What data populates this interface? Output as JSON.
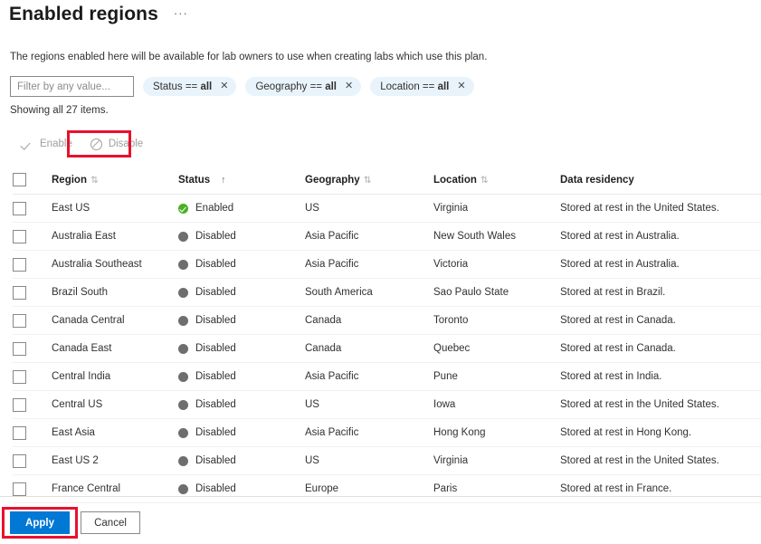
{
  "header": {
    "title": "Enabled regions",
    "ellipsis_label": "···"
  },
  "description": "The regions enabled here will be available for lab owners to use when creating labs which use this plan.",
  "filters": {
    "search_placeholder": "Filter by any value...",
    "search_value": "",
    "pills": [
      {
        "field": "Status",
        "operator": "==",
        "value": "all",
        "close_label": "✕"
      },
      {
        "field": "Geography",
        "operator": "==",
        "value": "all",
        "close_label": "✕"
      },
      {
        "field": "Location",
        "operator": "==",
        "value": "all",
        "close_label": "✕"
      }
    ]
  },
  "showing_text": "Showing all 27 items.",
  "commandbar": {
    "enable_label": "Enable",
    "disable_label": "Disable",
    "enable_icon": "check-icon",
    "disable_icon": "circle-slash-icon",
    "enable_disabled": true,
    "disable_disabled": true
  },
  "table": {
    "columns": [
      {
        "key": "region",
        "label": "Region",
        "sort": "⇅",
        "sort_active": false
      },
      {
        "key": "status",
        "label": "Status",
        "sort": "↑",
        "sort_active": true
      },
      {
        "key": "geography",
        "label": "Geography",
        "sort": "⇅",
        "sort_active": false
      },
      {
        "key": "location",
        "label": "Location",
        "sort": "⇅",
        "sort_active": false
      },
      {
        "key": "data_residency",
        "label": "Data residency",
        "sort": "",
        "sort_active": false
      }
    ],
    "rows": [
      {
        "selected": false,
        "region": "East US",
        "status": "Enabled",
        "status_state": "enabled",
        "geography": "US",
        "location": "Virginia",
        "data_residency": "Stored at rest in the United States."
      },
      {
        "selected": false,
        "region": "Australia East",
        "status": "Disabled",
        "status_state": "disabled",
        "geography": "Asia Pacific",
        "location": "New South Wales",
        "data_residency": "Stored at rest in Australia."
      },
      {
        "selected": false,
        "region": "Australia Southeast",
        "status": "Disabled",
        "status_state": "disabled",
        "geography": "Asia Pacific",
        "location": "Victoria",
        "data_residency": "Stored at rest in Australia."
      },
      {
        "selected": false,
        "region": "Brazil South",
        "status": "Disabled",
        "status_state": "disabled",
        "geography": "South America",
        "location": "Sao Paulo State",
        "data_residency": "Stored at rest in Brazil."
      },
      {
        "selected": false,
        "region": "Canada Central",
        "status": "Disabled",
        "status_state": "disabled",
        "geography": "Canada",
        "location": "Toronto",
        "data_residency": "Stored at rest in Canada."
      },
      {
        "selected": false,
        "region": "Canada East",
        "status": "Disabled",
        "status_state": "disabled",
        "geography": "Canada",
        "location": "Quebec",
        "data_residency": "Stored at rest in Canada."
      },
      {
        "selected": false,
        "region": "Central India",
        "status": "Disabled",
        "status_state": "disabled",
        "geography": "Asia Pacific",
        "location": "Pune",
        "data_residency": "Stored at rest in India."
      },
      {
        "selected": false,
        "region": "Central US",
        "status": "Disabled",
        "status_state": "disabled",
        "geography": "US",
        "location": "Iowa",
        "data_residency": "Stored at rest in the United States."
      },
      {
        "selected": false,
        "region": "East Asia",
        "status": "Disabled",
        "status_state": "disabled",
        "geography": "Asia Pacific",
        "location": "Hong Kong",
        "data_residency": "Stored at rest in Hong Kong."
      },
      {
        "selected": false,
        "region": "East US 2",
        "status": "Disabled",
        "status_state": "disabled",
        "geography": "US",
        "location": "Virginia",
        "data_residency": "Stored at rest in the United States."
      },
      {
        "selected": false,
        "region": "France Central",
        "status": "Disabled",
        "status_state": "disabled",
        "geography": "Europe",
        "location": "Paris",
        "data_residency": "Stored at rest in France."
      }
    ]
  },
  "footer": {
    "apply_label": "Apply",
    "cancel_label": "Cancel"
  },
  "colors": {
    "accent": "#0078d4",
    "enabled_green": "#4ab024",
    "disabled_gray": "#6e6e6e",
    "pill_bg": "#e9f3fb",
    "annotation_red": "#e8112d"
  }
}
